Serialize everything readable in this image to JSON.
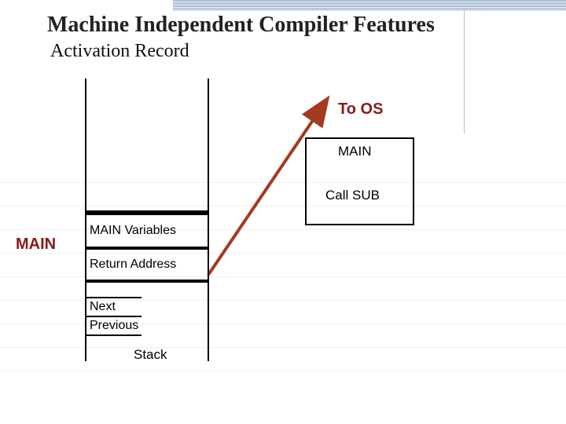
{
  "title": "Machine Independent Compiler Features",
  "subtitle": "Activation Record",
  "labels": {
    "to_os": "To OS",
    "main_side": "MAIN"
  },
  "codebox": {
    "line1": "MAIN",
    "line2": "Call SUB"
  },
  "stack": {
    "cells": {
      "vars": "MAIN Variables",
      "ret": "Return Address",
      "next": "Next",
      "prev": "Previous"
    },
    "bottom_label": "Stack"
  }
}
